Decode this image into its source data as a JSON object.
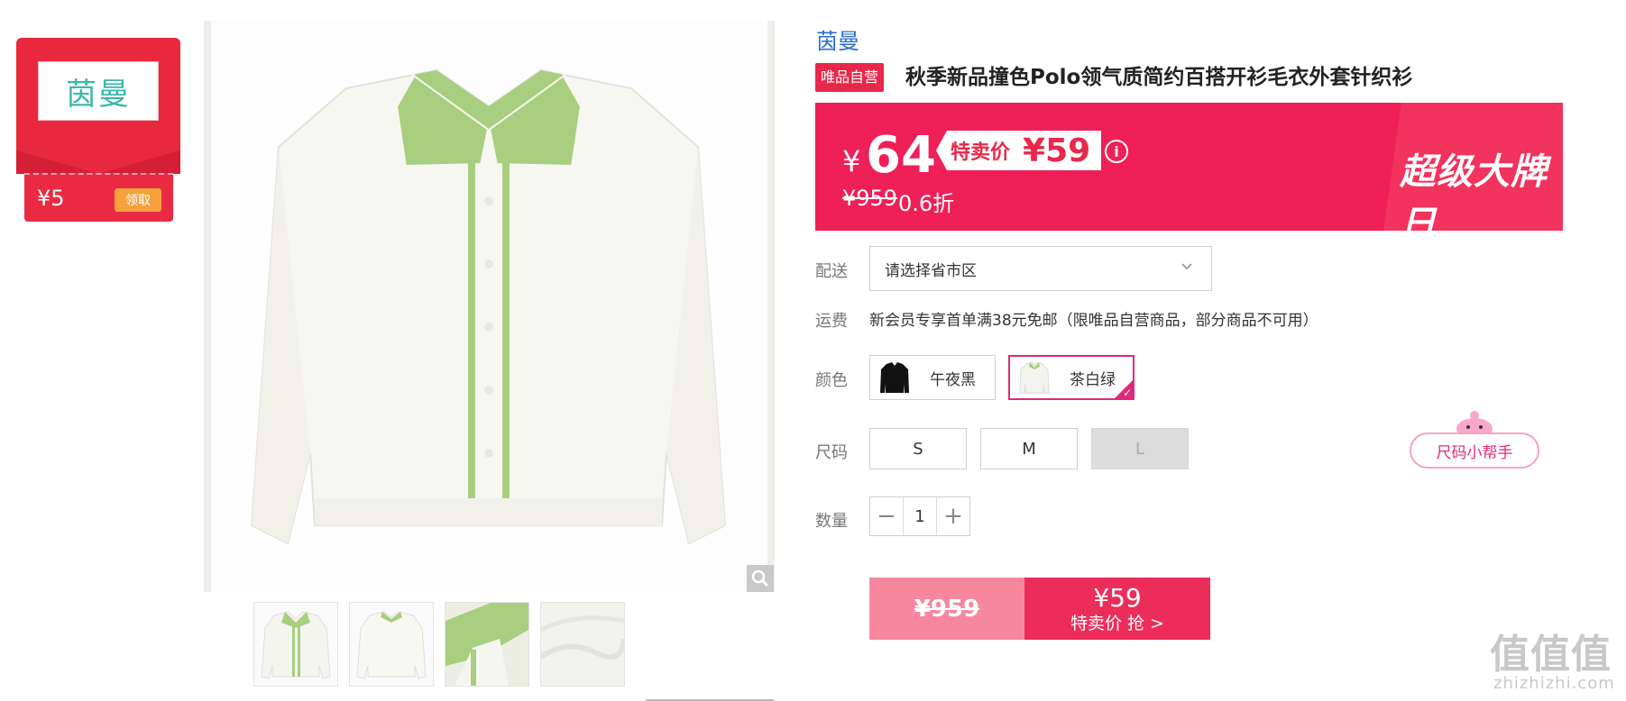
{
  "brand_card": {
    "logo_text": "茵曼",
    "coupon_amount": "¥5",
    "coupon_button": "领取"
  },
  "product": {
    "brand": "茵曼",
    "self_badge": "唯品自营",
    "title": "秋季新品撞色Polo领气质简约百搭开衫毛衣外套针织衫"
  },
  "price": {
    "currency": "¥",
    "current": "64",
    "sale_label": "特卖价",
    "sale_price": "¥59",
    "original": "¥959",
    "discount": "0.6折",
    "promo_title": "超级大牌日",
    "info_icon": "i"
  },
  "shipping": {
    "label": "配送",
    "placeholder": "请选择省市区"
  },
  "freight": {
    "label": "运费",
    "text": "新会员专享首单满38元免邮（限唯品自营商品，部分商品不可用）"
  },
  "color": {
    "label": "颜色",
    "options": [
      {
        "name": "午夜黑",
        "selected": false,
        "swatch_color": "#111111"
      },
      {
        "name": "茶白绿",
        "selected": true,
        "swatch_color": "#f4f4ee"
      }
    ]
  },
  "size": {
    "label": "尺码",
    "options": [
      {
        "name": "S",
        "available": true
      },
      {
        "name": "M",
        "available": true
      },
      {
        "name": "L",
        "available": false
      }
    ],
    "helper": "尺码小帮手"
  },
  "quantity": {
    "label": "数量",
    "value": "1",
    "minus": "−",
    "plus": "+"
  },
  "buy": {
    "original": "¥959",
    "price": "¥59",
    "action": "特卖价 抢 >"
  },
  "watermark": {
    "main": "值值值",
    "sub": "zhizhizhi.com"
  },
  "colors": {
    "accent": "#ef1f57",
    "brand_blue": "#2a6fce",
    "selected_border": "#e0297a",
    "garment_green": "#a8cf7f"
  }
}
